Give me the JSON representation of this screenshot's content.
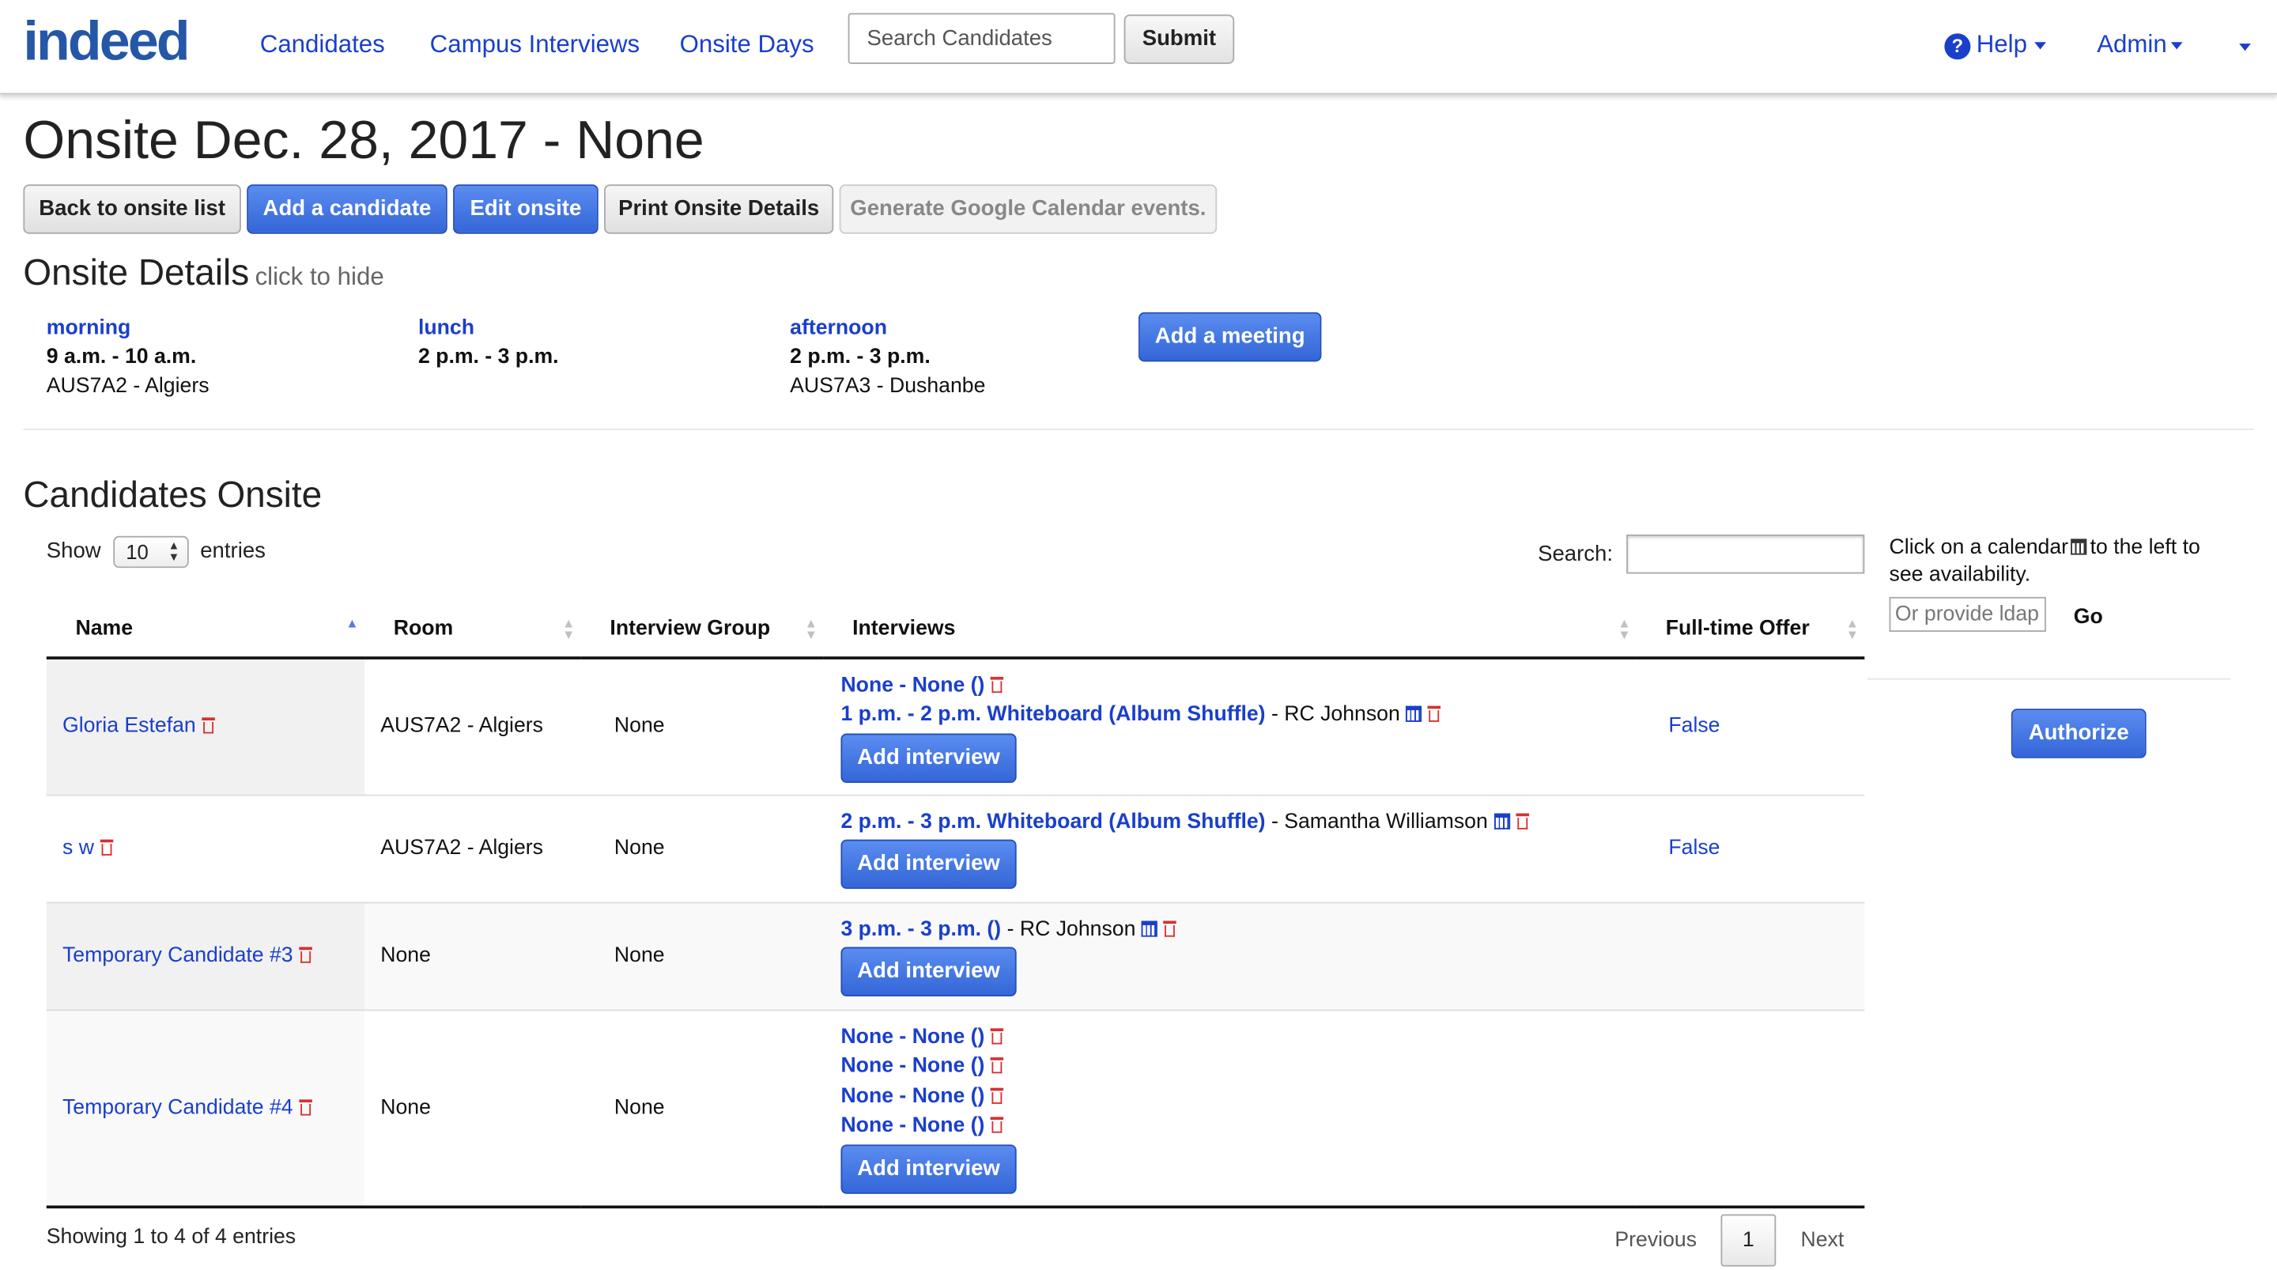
{
  "brand": {
    "logo_text": "indeed",
    "colors": {
      "link": "#1a3fcc",
      "primary": "#3466d8",
      "danger": "#d83030"
    }
  },
  "nav": {
    "links": [
      "Candidates",
      "Campus Interviews",
      "Onsite Days"
    ],
    "search_placeholder": "Search Candidates",
    "submit_label": "Submit",
    "help_label": "Help",
    "admin_label": "Admin"
  },
  "page": {
    "title": "Onsite Dec. 28, 2017 - None",
    "buttons": {
      "back": "Back to onsite list",
      "add_candidate": "Add a candidate",
      "edit_onsite": "Edit onsite",
      "print": "Print Onsite Details",
      "google_cal": "Generate Google Calendar events."
    }
  },
  "onsite_details": {
    "title": "Onsite Details",
    "toggle_label": "click to hide",
    "meetings": [
      {
        "name": "morning",
        "time": "9 a.m. - 10 a.m.",
        "room": "AUS7A2 - Algiers"
      },
      {
        "name": "lunch",
        "time": "2 p.m. - 3 p.m.",
        "room": ""
      },
      {
        "name": "afternoon",
        "time": "2 p.m. - 3 p.m.",
        "room": "AUS7A3 - Dushanbe"
      }
    ],
    "add_meeting_label": "Add a meeting"
  },
  "candidates": {
    "title": "Candidates Onsite",
    "show_label": "Show",
    "entries_value": "10",
    "entries_label": "entries",
    "search_label": "Search:",
    "columns": [
      "Name",
      "Room",
      "Interview Group",
      "Interviews",
      "Full-time Offer"
    ],
    "rows": [
      {
        "name": "Gloria Estefan",
        "room": "AUS7A2 - Algiers",
        "group": "None",
        "interviews": [
          {
            "title": "None - None ()",
            "interviewer": ""
          },
          {
            "title": "1 p.m. - 2 p.m. Whiteboard (Album Shuffle)",
            "interviewer": "- RC Johnson"
          }
        ],
        "offer": "False"
      },
      {
        "name": "s w",
        "room": "AUS7A2 - Algiers",
        "group": "None",
        "interviews": [
          {
            "title": "2 p.m. - 3 p.m. Whiteboard (Album Shuffle)",
            "interviewer": "- Samantha Williamson"
          }
        ],
        "offer": "False"
      },
      {
        "name": "Temporary Candidate #3",
        "room": "None",
        "group": "None",
        "interviews": [
          {
            "title": "3 p.m. - 3 p.m. ()",
            "interviewer": "- RC Johnson"
          }
        ],
        "offer": ""
      },
      {
        "name": "Temporary Candidate #4",
        "room": "None",
        "group": "None",
        "interviews": [
          {
            "title": "None - None ()",
            "interviewer": ""
          },
          {
            "title": "None - None ()",
            "interviewer": ""
          },
          {
            "title": "None - None ()",
            "interviewer": ""
          },
          {
            "title": "None - None ()",
            "interviewer": ""
          }
        ],
        "offer": ""
      }
    ],
    "add_interview_label": "Add interview",
    "showing_text": "Showing 1 to 4 of 4 entries",
    "pagination": {
      "previous": "Previous",
      "page": "1",
      "next": "Next"
    }
  },
  "availability": {
    "note_before": "Click on a calendar",
    "note_after": "to the left to see availability.",
    "ldap_placeholder": "Or provide ldap",
    "go_label": "Go",
    "authorize_label": "Authorize"
  }
}
